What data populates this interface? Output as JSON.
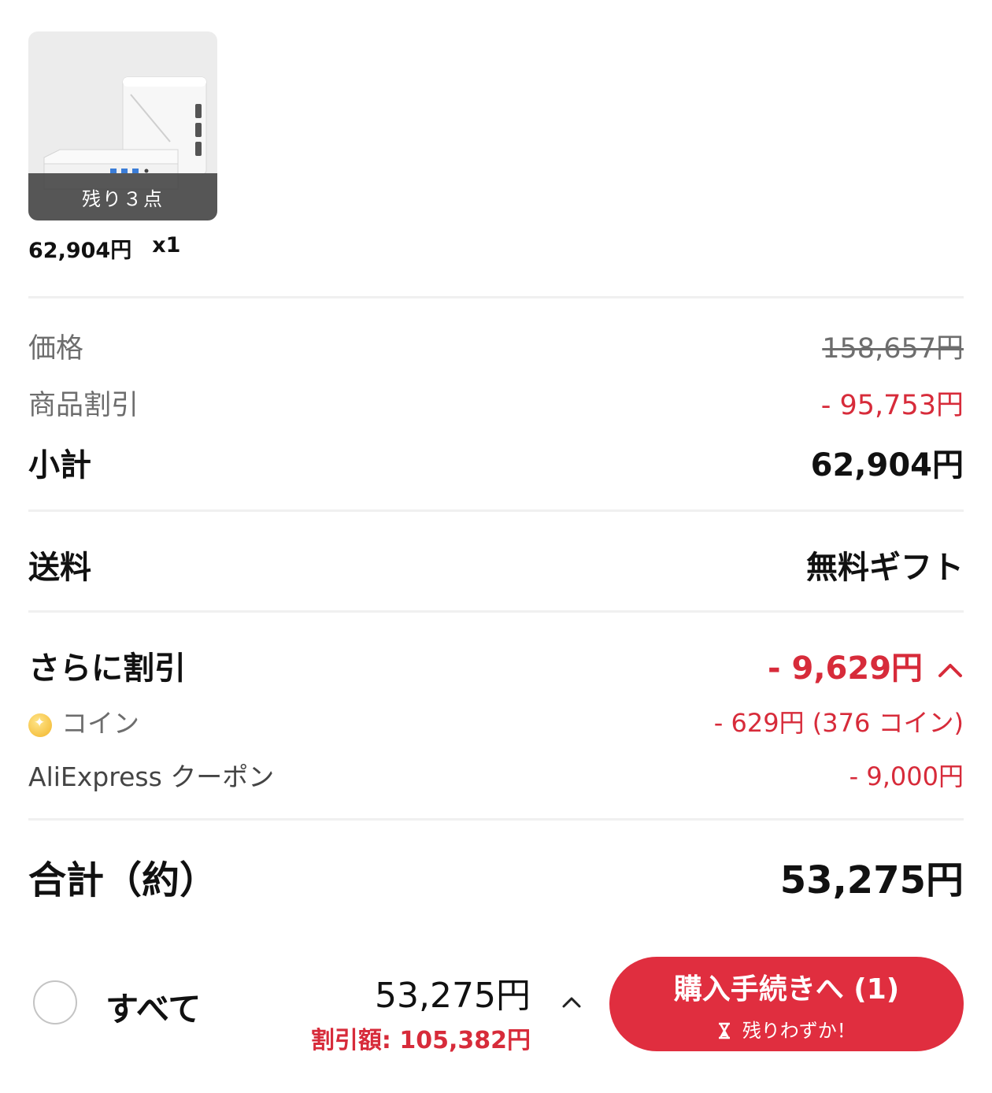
{
  "product": {
    "stock_badge": "残り３点",
    "unit_price": "62,904円",
    "quantity": "x1",
    "image_icon": "mini-pc-product-image"
  },
  "summary": {
    "price_label": "価格",
    "price_value": "158,657円",
    "item_discount_label": "商品割引",
    "item_discount_value": "- 95,753円",
    "subtotal_label": "小計",
    "subtotal_value": "62,904円",
    "shipping_label": "送料",
    "shipping_value": "無料ギフト",
    "extra_discount_label": "さらに割引",
    "extra_discount_value": "- 9,629円",
    "extra_discount_toggle_icon": "chevron-up-icon",
    "coin_label": "コイン",
    "coin_value": "- 629円 (376 コイン)",
    "coupon_label": "AliExpress クーポン",
    "coupon_value": "- 9,000円",
    "total_label": "合計（約）",
    "total_value": "53,275円"
  },
  "footer": {
    "select_all_label": "すべて",
    "total_price": "53,275円",
    "discount_amount": "割引額: 105,382円",
    "checkout_label": "購入手続きへ (1)",
    "checkout_sub": "残りわずか！",
    "checkout_sub_icon": "hourglass-icon",
    "caret_icon": "chevron-up-icon"
  },
  "colors": {
    "accent_red": "#d72b3a",
    "button_red": "#e02e3f"
  }
}
